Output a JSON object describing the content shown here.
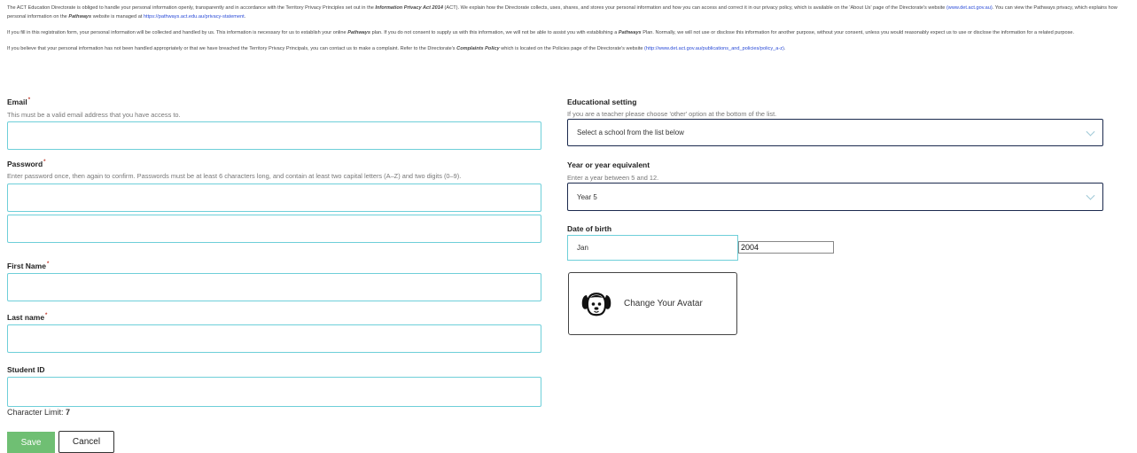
{
  "privacy": {
    "p1_a": "The ACT Education Directorate is obliged to handle your personal information openly, transparently and in accordance with the Territory Privacy Principles set out in the ",
    "p1_act": "Information Privacy Act 2014",
    "p1_b": " (ACT). We explain how the Directorate collects, uses, shares, and stores your personal information and how you can access and correct it in our privacy policy, which is available on the 'About Us' page of the Directorate's website ",
    "p1_link1": "(www.det.act.gov.au)",
    "p1_c": ". You can view the Pathways privacy, which explains how personal information on the ",
    "p1_pathways": "Pathways",
    "p1_d": " website is managed at ",
    "p1_link2": "https://pathways.act.edu.au/privacy-statement",
    "p1_e": ".",
    "p2_a": "If you fill in this registration form, your personal information will be collected and handled by us. This information is necessary for us to establish your online ",
    "p2_pathways1": "Pathways",
    "p2_b": " plan. If you do not consent to supply us with this information, we will not be able to assist you with establishing a ",
    "p2_pathways2": "Pathways",
    "p2_c": " Plan. Normally, we will not use or disclose this information for another purpose, without your consent, unless you would reasonably expect us to use or disclose the information for a related purpose.",
    "p3_a": "If you believe that your personal information has not been handled appropriately or that we have breached the Territory Privacy Principals, you can contact us to make a complaint. Refer to the Directorate's ",
    "p3_policy": "Complaints Policy",
    "p3_b": " which is located on the Policies page of the Directorate's website ",
    "p3_link": "(http://www.det.act.gov.au/publications_and_policies/policy_a-z)",
    "p3_c": "."
  },
  "form": {
    "email_label": "Email",
    "email_hint": "This must be a valid email address that you have access to.",
    "password_label": "Password",
    "password_hint": "Enter password once, then again to confirm. Passwords must be at least 6 characters long, and contain at least two capital letters (A–Z) and two digits (0–9).",
    "first_name_label": "First Name",
    "last_name_label": "Last name",
    "student_id_label": "Student ID",
    "required_marker": "*",
    "char_limit_label": "Character Limit: ",
    "char_limit_value": "7",
    "edu_setting_label": "Educational setting",
    "edu_setting_hint": "If you are a teacher please choose 'other' option at the bottom of the list.",
    "edu_setting_value": "Select a school from the list below",
    "year_label": "Year or year equivalent",
    "year_hint": "Enter a year between 5 and 12.",
    "year_value": "Year 5",
    "dob_label": "Date of birth",
    "dob_month": "Jan",
    "dob_year": "2004",
    "avatar_button": "Change Your Avatar",
    "save_button": "Save",
    "cancel_button": "Cancel"
  },
  "icons": {
    "avatar": "dog-face-icon",
    "select_arrow": "chevron-down-icon"
  },
  "colors": {
    "field_border": "#6ecfd9",
    "select_border": "#1b2a4e",
    "save_bg": "#6fbf73",
    "link": "#2a4bd7"
  }
}
